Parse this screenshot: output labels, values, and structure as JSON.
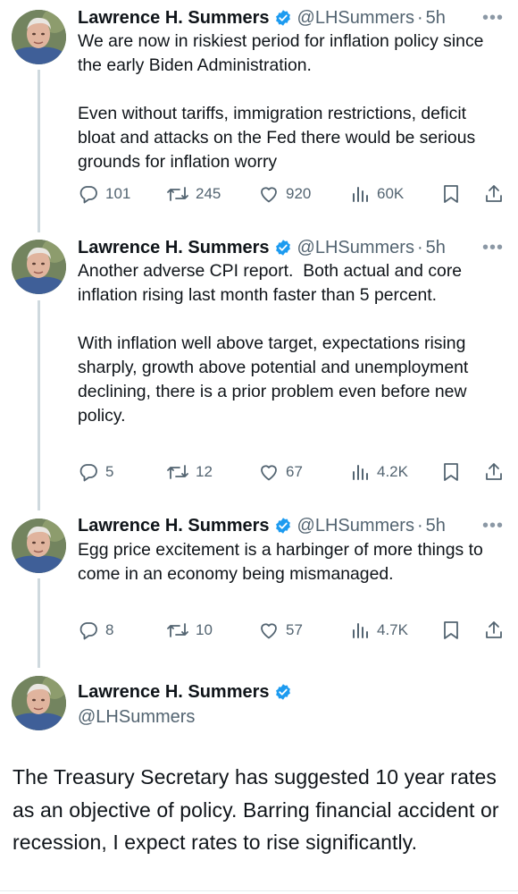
{
  "author": {
    "name": "Lawrence H. Summers",
    "handle": "@LHSummers"
  },
  "colors": {
    "verified": "#1d9bf0",
    "secondary_text": "#536471",
    "thread_line": "#cfd9de"
  },
  "icons": [
    "reply-icon",
    "retweet-icon",
    "like-icon",
    "views-icon",
    "bookmark-icon",
    "share-icon",
    "verified-icon",
    "more-icon"
  ],
  "tweets": [
    {
      "time": "5h",
      "more": "•••",
      "text": "We are now in riskiest period for inflation policy since the early Biden Administration.\n\nEven without tariffs, immigration restrictions, deficit bloat and attacks on the Fed there would be serious grounds for inflation worry",
      "replies": "101",
      "retweets": "245",
      "likes": "920",
      "views": "60K"
    },
    {
      "time": "5h",
      "more": "•••",
      "text": "Another adverse CPI report.  Both actual and core inflation rising last month faster than 5 percent.\n\nWith inflation well above target, expectations rising sharply, growth above potential and unemployment declining, there is a prior problem even before new policy.",
      "replies": "5",
      "retweets": "12",
      "likes": "67",
      "views": "4.2K"
    },
    {
      "time": "5h",
      "more": "•••",
      "text": "Egg price excitement is a harbinger of more things to come in an economy being mismanaged.",
      "replies": "8",
      "retweets": "10",
      "likes": "57",
      "views": "4.7K"
    }
  ],
  "main_tweet": {
    "text": "The Treasury Secretary has suggested 10 year rates as an objective of policy. Barring financial accident or recession, I expect rates to rise significantly."
  }
}
